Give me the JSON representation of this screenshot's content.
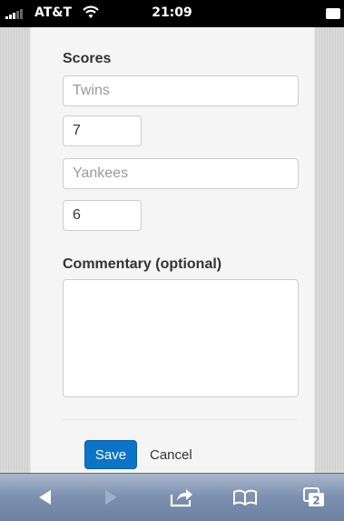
{
  "status_bar": {
    "carrier": "AT&T",
    "time": "21:09"
  },
  "form": {
    "scores_heading": "Scores",
    "team1": {
      "placeholder": "Twins",
      "score": "7"
    },
    "team2": {
      "placeholder": "Yankees",
      "score": "6"
    },
    "commentary_label": "Commentary (optional)",
    "commentary_value": "",
    "save_label": "Save",
    "cancel_label": "Cancel"
  },
  "toolbar": {
    "tabs_count": "2",
    "icons": [
      "back-icon",
      "forward-icon",
      "share-icon",
      "bookmarks-icon",
      "tabs-icon"
    ]
  },
  "colors": {
    "primary_button": "#0b74c8",
    "toolbar": "#7b8fae"
  }
}
